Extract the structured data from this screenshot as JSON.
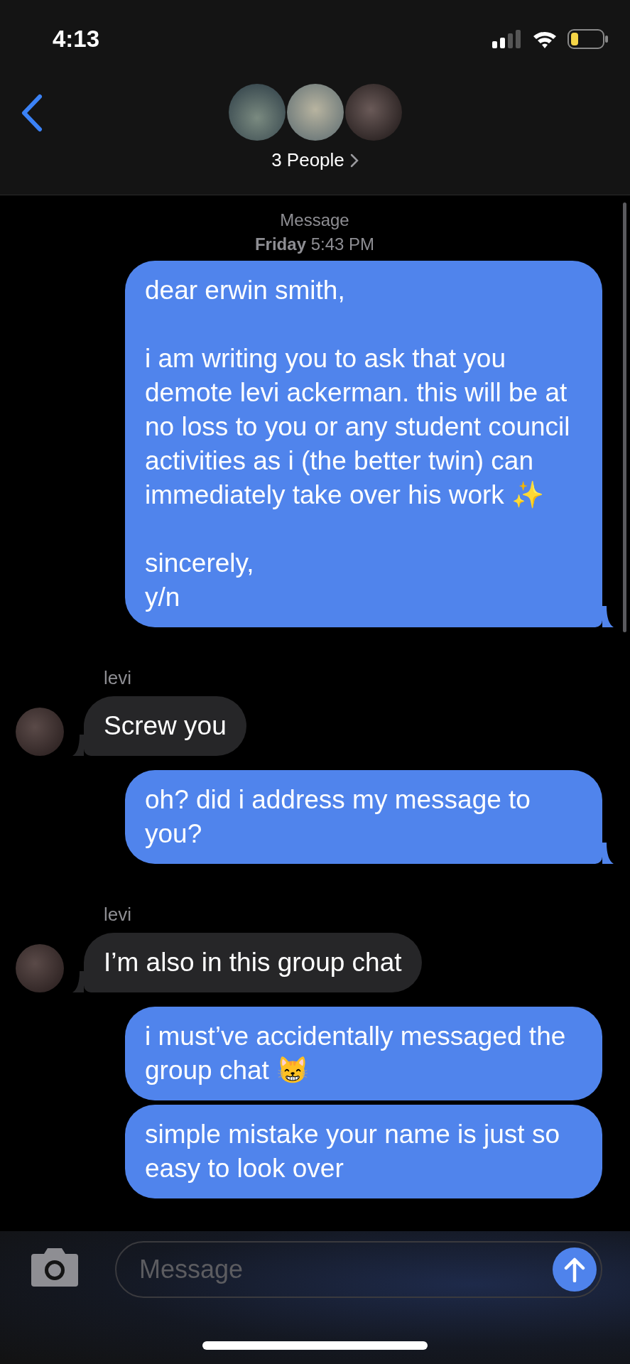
{
  "status_bar": {
    "time": "4:13"
  },
  "header": {
    "title": "3 People"
  },
  "thread": {
    "service_label": "Message",
    "day": "Friday",
    "time": "5:43 PM"
  },
  "messages": [
    {
      "kind": "sent",
      "text": "dear erwin smith,\n\ni am writing you to ask that you demote levi ackerman. this will be at no loss to you or any student council activities as i (the better twin) can immediately take over his work ✨\n\nsincerely,\ny/n",
      "tail": true
    },
    {
      "kind": "received",
      "sender": "levi",
      "text": "Screw you",
      "tail": true
    },
    {
      "kind": "sent",
      "text": "oh? did i address my message to you?",
      "tail": true
    },
    {
      "kind": "received",
      "sender": "levi",
      "text": "I’m also in this group chat",
      "tail": true
    },
    {
      "kind": "sent",
      "text": "i must’ve accidentally messaged the group chat 😸",
      "tail": false
    },
    {
      "kind": "sent",
      "text": "simple mistake your name is just so easy to look over",
      "tail": false
    }
  ],
  "composer": {
    "placeholder": "Message"
  }
}
